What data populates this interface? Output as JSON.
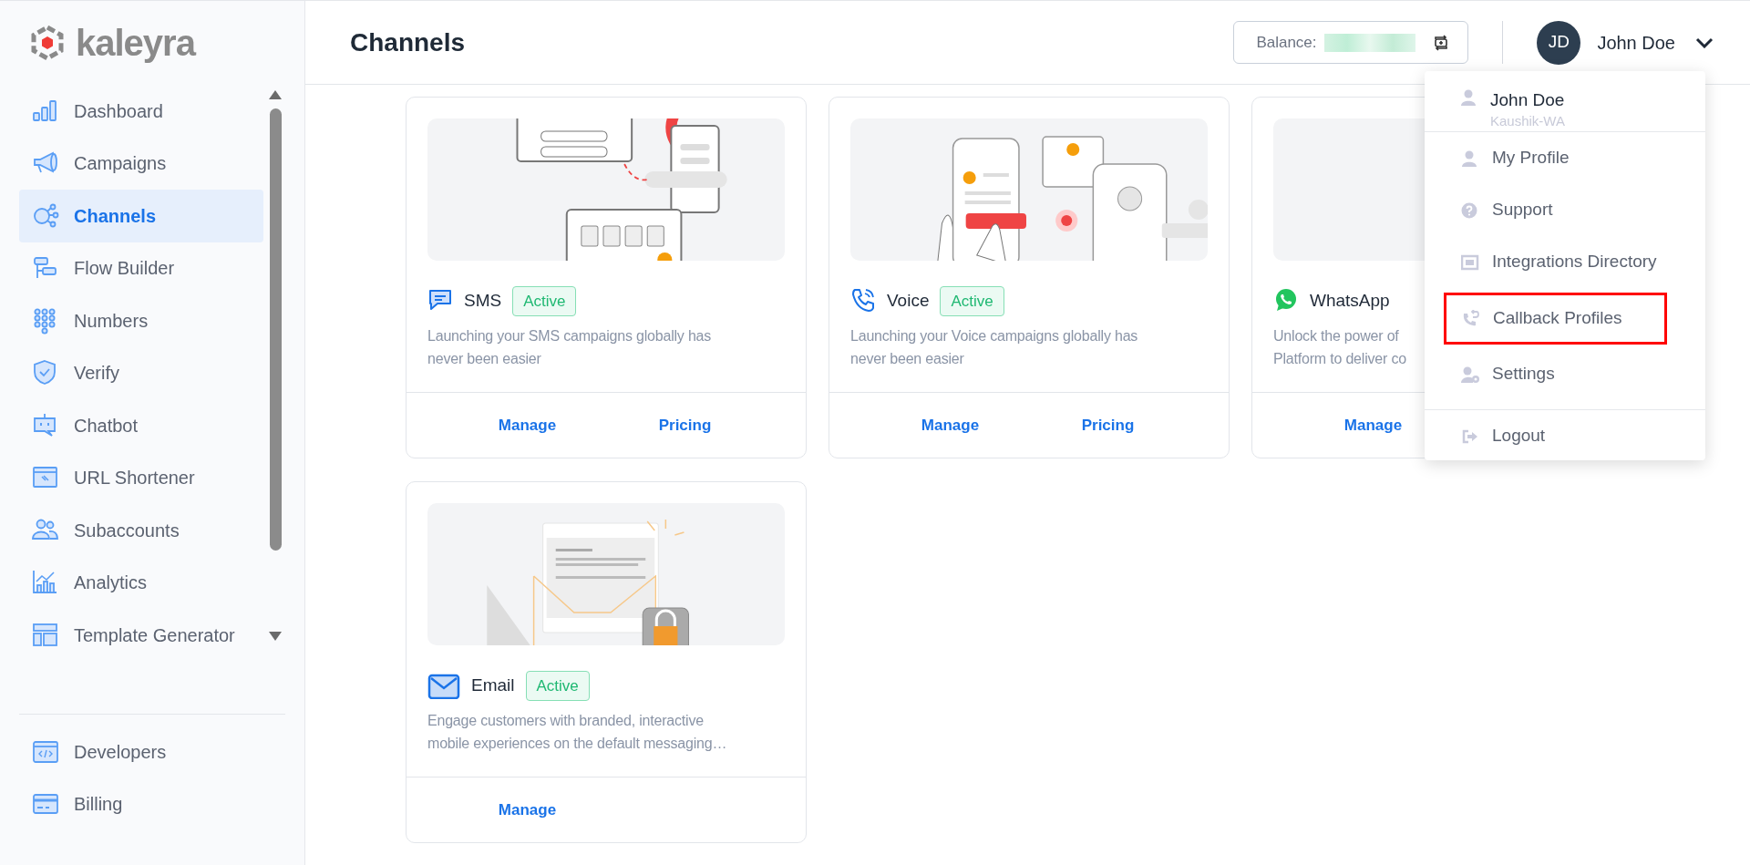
{
  "sidebar": {
    "logo": "kaleyra",
    "items": [
      {
        "label": "Dashboard",
        "selected": false
      },
      {
        "label": "Campaigns",
        "selected": false
      },
      {
        "label": "Channels",
        "selected": true
      },
      {
        "label": "Flow Builder",
        "selected": false
      },
      {
        "label": "Numbers",
        "selected": false
      },
      {
        "label": "Verify",
        "selected": false
      },
      {
        "label": "Chatbot",
        "selected": false
      },
      {
        "label": "URL Shortener",
        "selected": false
      },
      {
        "label": "Subaccounts",
        "selected": false
      },
      {
        "label": "Analytics",
        "selected": false
      },
      {
        "label": "Template Generator",
        "selected": false
      }
    ],
    "bottom_items": [
      {
        "label": "Developers",
        "selected": false
      },
      {
        "label": "Billing",
        "selected": false
      }
    ]
  },
  "header": {
    "title": "Channels",
    "balance_label": "Balance:",
    "user": {
      "initials": "JD",
      "name": "John Doe"
    }
  },
  "channels": [
    {
      "name": "SMS",
      "status": "Active",
      "description_lines": [
        "Launching your SMS campaigns globally has",
        "never been easier"
      ],
      "actions": [
        "Manage",
        "Pricing"
      ]
    },
    {
      "name": "Voice",
      "status": "Active",
      "description_lines": [
        "Launching your Voice campaigns globally has",
        "never been easier"
      ],
      "actions": [
        "Manage",
        "Pricing"
      ]
    },
    {
      "name": "WhatsApp",
      "description_lines": [
        "Unlock the power of",
        "Platform to deliver co"
      ],
      "actions": [
        "Manage"
      ]
    },
    {
      "name": "Email",
      "status": "Active",
      "description_lines": [
        "Engage customers with branded, interactive",
        "mobile experiences on the default messaging…"
      ],
      "actions": [
        "Manage"
      ]
    }
  ],
  "user_menu": {
    "name": "John Doe",
    "account": "Kaushik-WA",
    "items": [
      {
        "label": "My Profile",
        "highlighted": false
      },
      {
        "label": "Support",
        "highlighted": false
      },
      {
        "label": "Integrations Directory",
        "highlighted": false
      },
      {
        "label": "Callback Profiles",
        "highlighted": true
      },
      {
        "label": "Settings",
        "highlighted": false
      },
      {
        "label": "Logout",
        "highlighted": false
      }
    ]
  }
}
